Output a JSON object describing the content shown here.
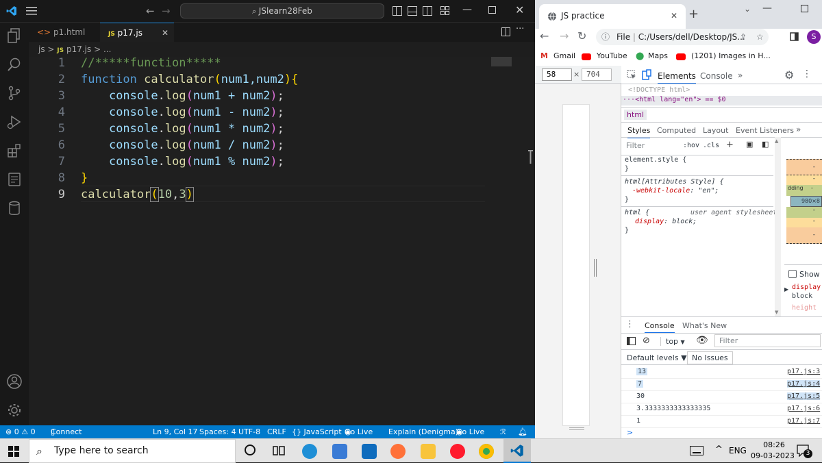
{
  "vscode": {
    "search_text": "JSlearn28Feb",
    "tabs": [
      {
        "label": "p1.html",
        "icon": "<>"
      },
      {
        "label": "p17.js",
        "icon": "JS"
      }
    ],
    "breadcrumb": {
      "folder": "js",
      "file": "p17.js",
      "more": "..."
    },
    "line_numbers": [
      "1",
      "2",
      "3",
      "4",
      "5",
      "6",
      "7",
      "8",
      "9"
    ],
    "code": {
      "l1": "//*****function*****",
      "l2_kw": "function",
      "l2_fn": "calculator",
      "l2_params": "num1,num2",
      "l3_obj": "console",
      "l3_fn": "log",
      "l3_expr": "num1 + num2",
      "l4_expr": "num1 - num2",
      "l5_expr": "num1 * num2",
      "l6_expr": "num1 / num2",
      "l7_expr": "num1 % num2",
      "l9_fn": "calculator",
      "l9_a": "10",
      "l9_b": "3"
    },
    "status": {
      "problems": "⊗ 0 ⚠ 0",
      "connect": "Connect",
      "position": "Ln 9, Col 17",
      "spaces": "Spaces: 4",
      "encoding": "UTF-8",
      "eol": "CRLF",
      "language": "{} JavaScript",
      "golive1": "Go Live",
      "explain": "Explain (Denigma)",
      "golive2": "Go Live"
    }
  },
  "chrome": {
    "tab_title": "JS practice",
    "address": "C:/Users/dell/Desktop/JS...",
    "file_label": "File",
    "profile_initial": "S",
    "bookmarks": [
      "Gmail",
      "YouTube",
      "Maps",
      "(1201) Images in H..."
    ],
    "devtools": {
      "width": "58",
      "height": "704",
      "tabs": [
        "Elements",
        "Console",
        "»"
      ],
      "doctype": "<!DOCTYPE html>",
      "html_line": "<html lang=\"en\"> == $0",
      "breadcrumb": "html",
      "style_tabs": [
        "Styles",
        "Computed",
        "Layout",
        "Event Listeners",
        "»"
      ],
      "filter_placeholder": "Filter",
      "hov": ":hov",
      "cls": ".cls",
      "element_style": "element.style {",
      "close_brace": "}",
      "attr_style": "html[Attributes Style] {",
      "locale_prop": "-webkit-locale",
      "locale_val": "\"en\";",
      "ua_selector": "html {",
      "ua_label": "user agent stylesheet",
      "display_prop": "display",
      "display_val": "block;",
      "boxmodel_padding": "dding",
      "boxmodel_size": "980×8",
      "boxmodel_dash": "-",
      "show_all": "Show",
      "computed_prop": "display",
      "computed_val": "block",
      "computed_prop2": "height",
      "drawer_tabs": [
        "Console",
        "What's New"
      ],
      "context": "top",
      "console_filter": "Filter",
      "levels": "Default levels ▼",
      "issues": "No Issues",
      "logs": [
        {
          "value": "13",
          "source": "p17.js:3"
        },
        {
          "value": "7",
          "source": "p17.js:4"
        },
        {
          "value": "30",
          "source": "p17.js:5"
        },
        {
          "value": "3.3333333333333335",
          "source": "p17.js:6"
        },
        {
          "value": "1",
          "source": "p17.js:7"
        }
      ],
      "prompt": ">"
    }
  },
  "taskbar": {
    "search_placeholder": "Type here to search",
    "language": "ENG",
    "time": "08:26",
    "date": "09-03-2023",
    "notifications": "3"
  }
}
